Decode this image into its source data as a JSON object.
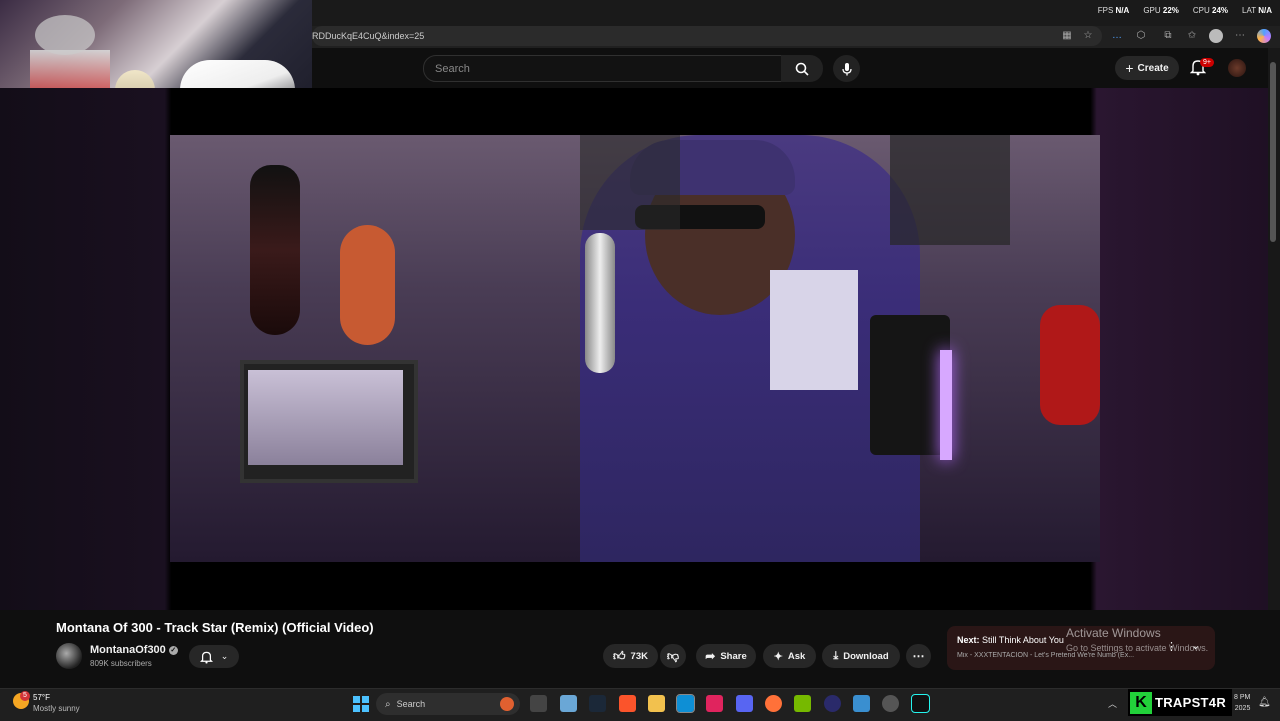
{
  "overlay": {
    "fps_label": "FPS",
    "fps_value": "N/A",
    "gpu_label": "GPU",
    "gpu_value": "22%",
    "cpu_label": "CPU",
    "cpu_value": "24%",
    "lat_label": "LAT",
    "lat_value": "N/A"
  },
  "browser": {
    "url": "RDDucKqE4CuQ&index=25"
  },
  "header": {
    "search_placeholder": "Search",
    "create_label": "Create",
    "notifications_badge": "9+"
  },
  "video": {
    "title": "Montana Of 300 - Track Star (Remix) (Official Video)",
    "channel_name": "MontanaOf300",
    "subscribers": "809K subscribers",
    "likes": "73K",
    "share_label": "Share",
    "ask_label": "Ask",
    "download_label": "Download"
  },
  "next": {
    "prefix": "Next:",
    "title": "Still Think About You",
    "mix": "Mix - XXXTENTACION - Let's Pretend We're Numb (Ex..."
  },
  "watermark": {
    "line1": "Activate Windows",
    "line2": "Go to Settings to activate Windows."
  },
  "taskbar": {
    "weather_badge": "5",
    "weather_temp": "57°F",
    "weather_desc": "Mostly sunny",
    "search_label": "Search",
    "brand": "TRAPST4R",
    "time": "8 PM",
    "date": "2025"
  },
  "colors": {
    "accent_red": "#cc0000",
    "brand_green": "#22d13a"
  }
}
